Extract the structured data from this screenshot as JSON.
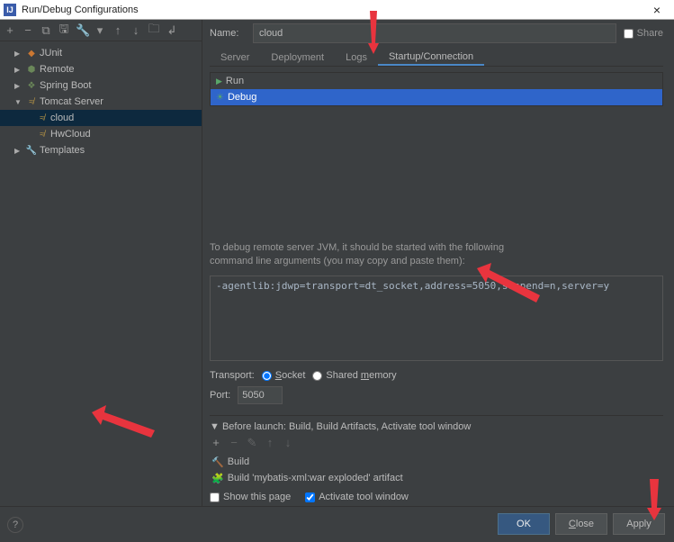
{
  "window": {
    "title": "Run/Debug Configurations"
  },
  "name_row": {
    "label": "Name:",
    "value": "cloud",
    "share_label": "Share"
  },
  "tree": {
    "junit": "JUnit",
    "remote": "Remote",
    "spring": "Spring Boot",
    "tomcat": "Tomcat Server",
    "cloud": "cloud",
    "hwcloud": "HwCloud",
    "templates": "Templates"
  },
  "tabs": {
    "server": "Server",
    "deployment": "Deployment",
    "logs": "Logs",
    "startup": "Startup/Connection"
  },
  "runmodes": {
    "run": "Run",
    "debug": "Debug"
  },
  "debug": {
    "hint1": "To debug remote server JVM, it should be started with the following",
    "hint2": "command line arguments (you may copy and paste them):",
    "cmd": "-agentlib:jdwp=transport=dt_socket,address=5050,suspend=n,server=y",
    "transport_label": "Transport:",
    "socket": "Socket",
    "shared": "Shared memory",
    "port_label": "Port:",
    "port_value": "5050"
  },
  "before": {
    "header": "Before launch: Build, Build Artifacts, Activate tool window",
    "build": "Build",
    "artifact": "Build 'mybatis-xml:war exploded' artifact",
    "show_page": "Show this page",
    "activate": "Activate tool window"
  },
  "buttons": {
    "ok": "OK",
    "close": "Close",
    "apply": "Apply"
  }
}
